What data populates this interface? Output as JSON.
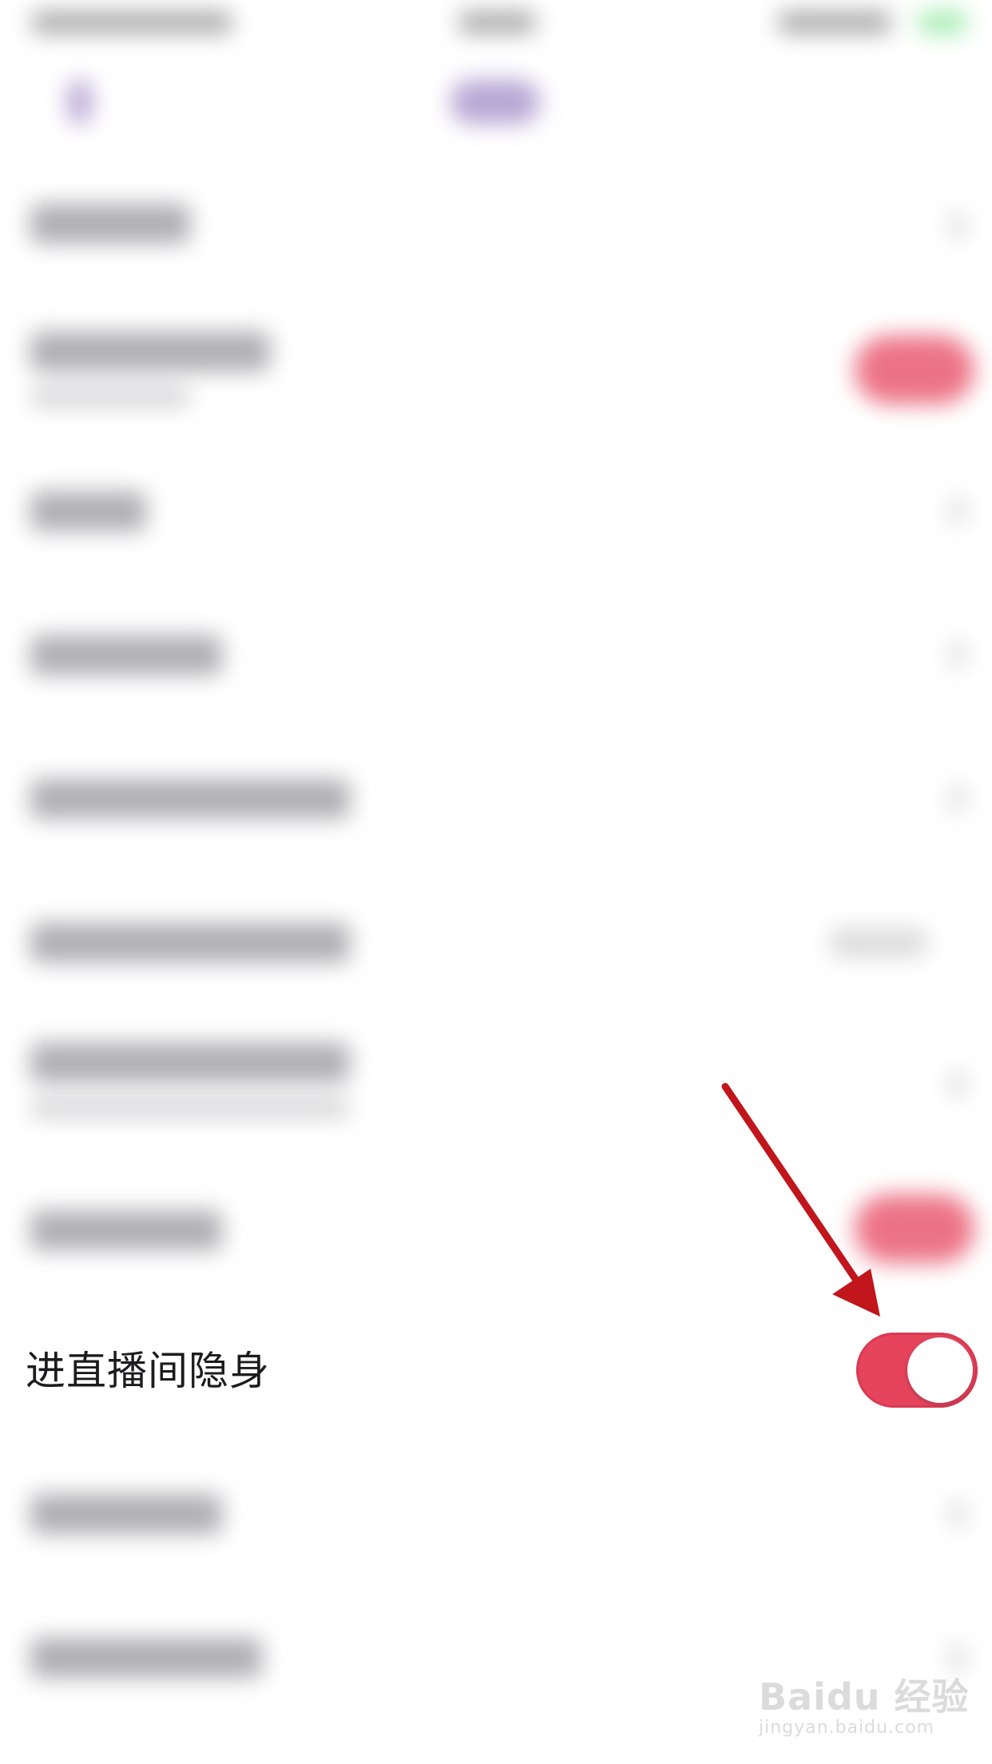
{
  "setting_row": {
    "label": "进直播间隐身",
    "toggle_on": true
  },
  "colors": {
    "toggle_active": "#e6445d",
    "annotation_arrow": "#c0161c",
    "accent_purple": "#7b5fb0"
  },
  "watermark": {
    "main": "Baidu 经验",
    "sub": "jingyan.baidu.com"
  }
}
